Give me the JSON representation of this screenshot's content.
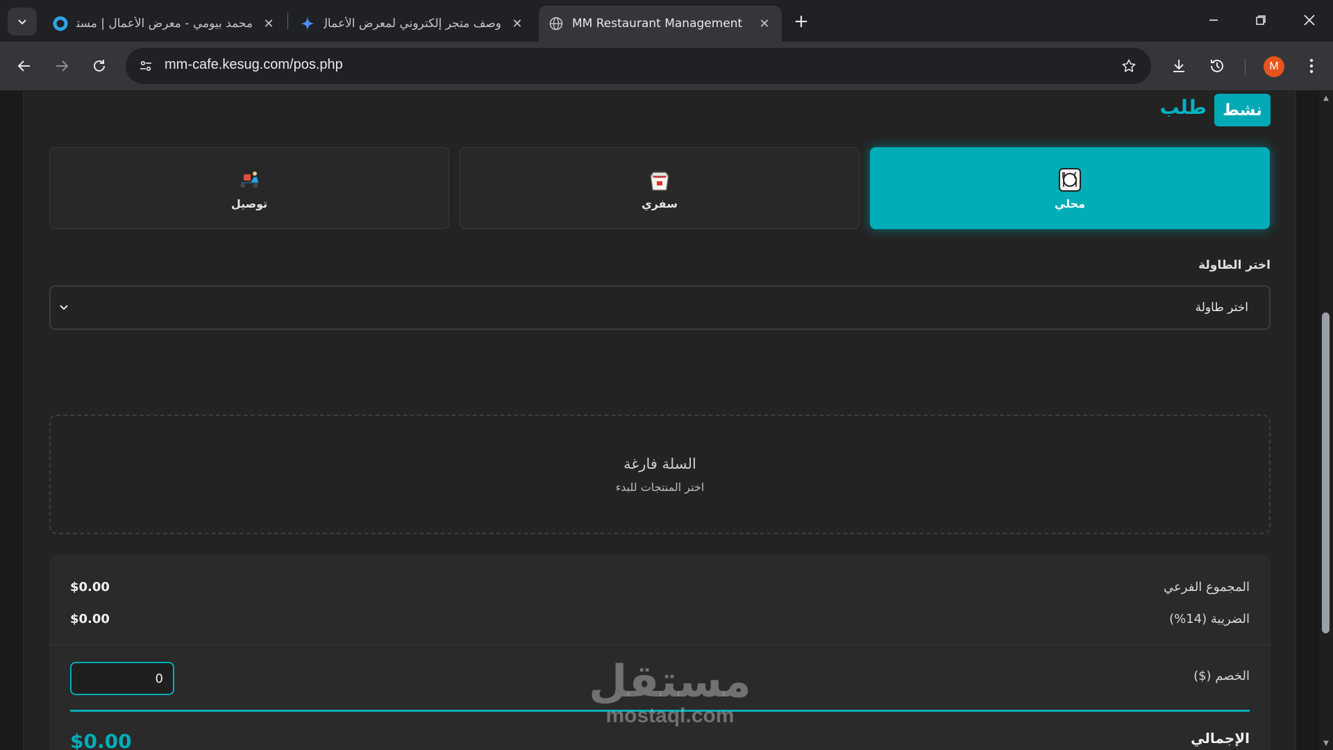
{
  "browser": {
    "tabs": [
      {
        "title": "محمد بيومي - معرض الأعمال | مستقل",
        "active": false
      },
      {
        "title": "وصف متجر إلكتروني لمعرض الأعمال",
        "active": false
      },
      {
        "title": "MM Restaurant Management",
        "active": true
      }
    ],
    "url": "mm-cafe.kesug.com/pos.php",
    "avatar_initial": "M",
    "icons": [
      "tab-search-icon",
      "close-icon",
      "new-tab-icon",
      "minimize-icon",
      "restore-icon",
      "back-icon",
      "forward-icon",
      "reload-icon",
      "site-info-icon",
      "bookmark-star-icon",
      "download-icon",
      "history-icon",
      "menu-icon"
    ]
  },
  "order": {
    "title": "طلب",
    "status": "نشط",
    "types": [
      {
        "id": "local",
        "label": "محلي",
        "icon": "dine-in-icon",
        "active": true
      },
      {
        "id": "takeaway",
        "label": "سفري",
        "icon": "takeaway-box-icon",
        "active": false
      },
      {
        "id": "delivery",
        "label": "توصيل",
        "icon": "delivery-scooter-icon",
        "active": false
      }
    ],
    "table_label": "اختر الطاولة",
    "table_select_value": "اختر طاولة"
  },
  "cart": {
    "empty_title": "السلة فارغة",
    "empty_hint": "اختر المنتجات للبدء"
  },
  "summary": {
    "subtotal_label": "المجموع الفرعي",
    "subtotal_value": "$0.00",
    "tax_label": "الضريبة (14%)",
    "tax_value": "$0.00",
    "discount_label": "الخصم ($)",
    "discount_value": "0",
    "total_label": "الإجمالي",
    "total_value": "$0.00"
  },
  "watermark": {
    "ar": "مستقل",
    "en": "mostaql.com"
  },
  "colors": {
    "accent": "#00adb8",
    "panel": "#232323",
    "card": "#282828"
  }
}
